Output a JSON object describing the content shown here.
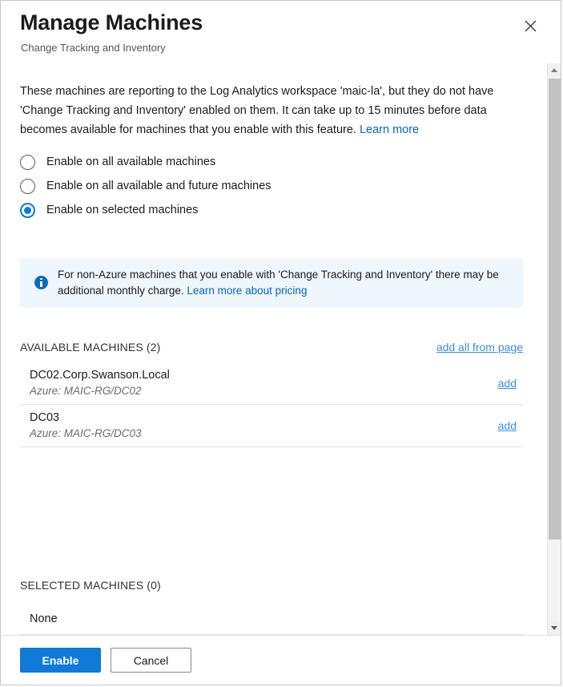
{
  "dialog": {
    "title": "Manage Machines",
    "subtitle": "Change Tracking and Inventory",
    "close_icon": "close-icon"
  },
  "description": {
    "text_before_link": "These machines are reporting to the Log Analytics workspace 'maic-la', but they do not have 'Change Tracking and Inventory' enabled on them. It can take up to 15 minutes before data becomes available for machines that you enable with this feature. ",
    "link_label": "Learn more"
  },
  "options": [
    {
      "label": "Enable on all available machines",
      "selected": false
    },
    {
      "label": "Enable on all available and future machines",
      "selected": false
    },
    {
      "label": "Enable on selected machines",
      "selected": true
    }
  ],
  "banner": {
    "icon": "info-icon",
    "text_before_link": "For non-Azure machines that you enable with 'Change Tracking and Inventory' there may be additional monthly charge. ",
    "link_label": "Learn more about pricing",
    "background_color": "#eff6fc",
    "icon_color": "#0f6cbd"
  },
  "available": {
    "heading": "AVAILABLE MACHINES (2)",
    "action_label": "add all from page",
    "rows": [
      {
        "name": "DC02.Corp.Swanson.Local",
        "detail": "Azure: MAIC-RG/DC02",
        "action_label": "add"
      },
      {
        "name": "DC03",
        "detail": "Azure: MAIC-RG/DC03",
        "action_label": "add"
      }
    ]
  },
  "selected": {
    "heading": "SELECTED MACHINES (0)",
    "empty_label": "None"
  },
  "scrollbar": {
    "up_icon": "chevron-up-icon",
    "down_icon": "chevron-down-icon"
  },
  "footer": {
    "primary_label": "Enable",
    "secondary_label": "Cancel",
    "primary_color": "#0f7ad8"
  }
}
